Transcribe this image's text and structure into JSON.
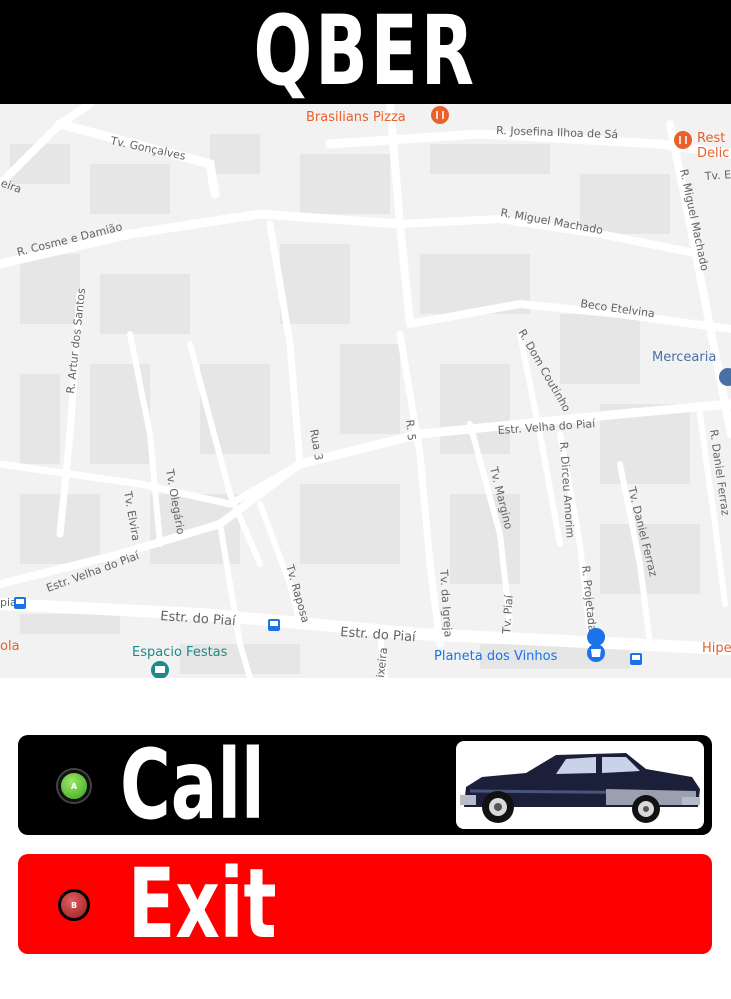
{
  "app": {
    "title": "QBER"
  },
  "map": {
    "streets": {
      "tv_goncalves": "Tv. Gonçalves",
      "r_josefina": "R. Josefina Ilhoa de Sá",
      "r_miguel_machado_h": "R. Miguel Machado",
      "r_miguel_machado_v": "R. Miguel Machado",
      "tv_top_right": "Tv. E",
      "r_cosme": "R. Cosme e Damião",
      "tv_edge_left": "eira",
      "beco_etelvina": "Beco Etelvina",
      "r_artur": "R. Artur dos Santos",
      "r_dom_coutinho": "R. Dom Coutinho",
      "rua3": "Rua 3",
      "r5": "R. 5",
      "estr_velha_piai_r": "Estr. Velha do Piaí",
      "r_daniel_ferraz": "R. Daniel Ferraz",
      "tv_oleg": "Tv. Olegário",
      "tv_elvira": "Tv. Elvira",
      "r_dirceu": "R. Dirceu Amorim",
      "tv_margino": "Tv. Margino",
      "tv_daniel_ferraz": "Tv. Daniel Ferraz",
      "estr_velha_piai_l": "Estr. Velha do Piaí",
      "tv_raposa": "Tv. Raposa",
      "r_projetada": "R. Projetada C",
      "tv_igreja": "Tv. da Igreja",
      "tv_piai": "Tv. Piaí",
      "estr_piai_1": "Estr. do Piaí",
      "estr_piai_2": "Estr. do Piaí",
      "piai_edge": "piaí",
      "rodrigues": "ixeira"
    },
    "pois": {
      "brasilians": "Brasilians Pizza",
      "restaurant_1": "Rest",
      "restaurant_2": "Delic",
      "mercearia": "Mercearia",
      "espacio": "Espacio Festas",
      "planeta": "Planeta dos Vinhos",
      "ola": "ola",
      "hipe": "Hipe"
    }
  },
  "buttons": {
    "call": {
      "label": "Call",
      "badge": "A",
      "image": "classic-car"
    },
    "exit": {
      "label": "Exit",
      "badge": "B"
    }
  },
  "colors": {
    "header_bg": "#000000",
    "call_bg": "#000000",
    "exit_bg": "#ff0000",
    "map_bg": "#f2f2f2",
    "poi_orange": "#e8602c",
    "poi_blue": "#1a73e8"
  }
}
